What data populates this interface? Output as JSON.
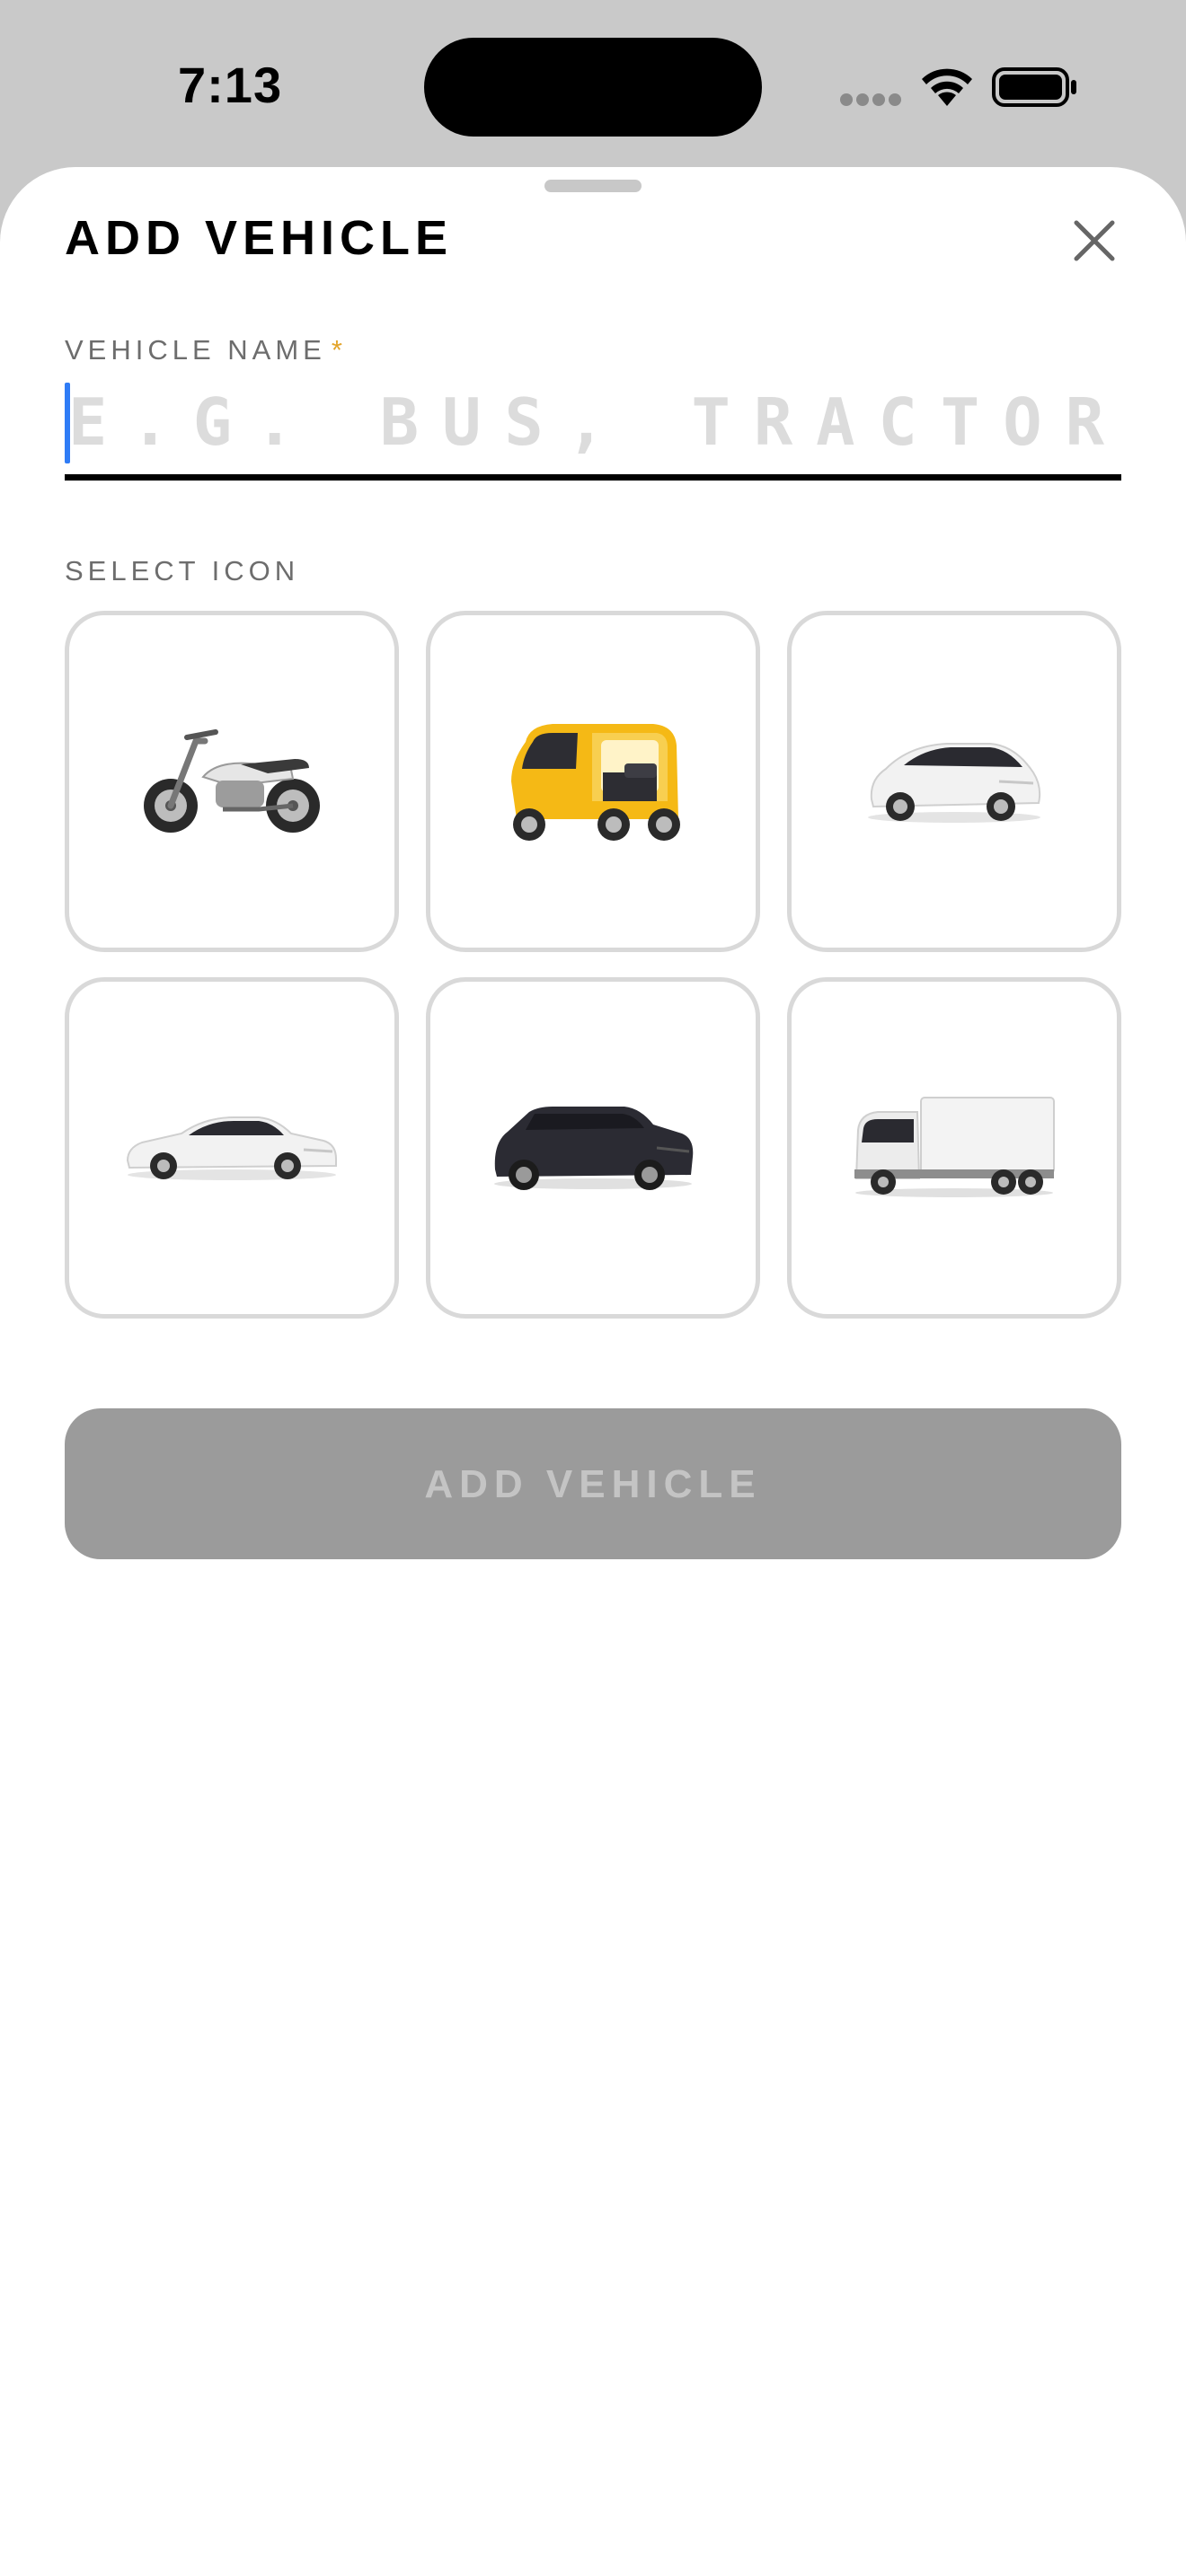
{
  "status_bar": {
    "time": "7:13",
    "icons": [
      "signal-icon",
      "wifi-icon",
      "battery-icon"
    ]
  },
  "sheet": {
    "title": "ADD VEHICLE",
    "close_icon": "close-icon"
  },
  "form": {
    "name_label": "VEHICLE NAME",
    "required_mark": "*",
    "name_value": "",
    "name_placeholder": "E.G. BUS, TRACTOR",
    "icon_section_label": "SELECT ICON",
    "icons": [
      {
        "name": "motorcycle-icon",
        "selected": false
      },
      {
        "name": "auto-rickshaw-icon",
        "selected": false
      },
      {
        "name": "hatchback-icon",
        "selected": false
      },
      {
        "name": "sedan-icon",
        "selected": false
      },
      {
        "name": "suv-icon",
        "selected": false
      },
      {
        "name": "truck-icon",
        "selected": false
      }
    ],
    "submit_label": "ADD VEHICLE",
    "submit_enabled": false
  },
  "colors": {
    "accent_required": "#e3a42a",
    "cursor": "#2f7cf6",
    "tile_border": "#d9d9d9",
    "button_disabled_bg": "#9b9b9b",
    "button_disabled_text": "#c4c4c4",
    "auto_rickshaw_yellow": "#f5b915",
    "suv_dark": "#2b2b33"
  }
}
